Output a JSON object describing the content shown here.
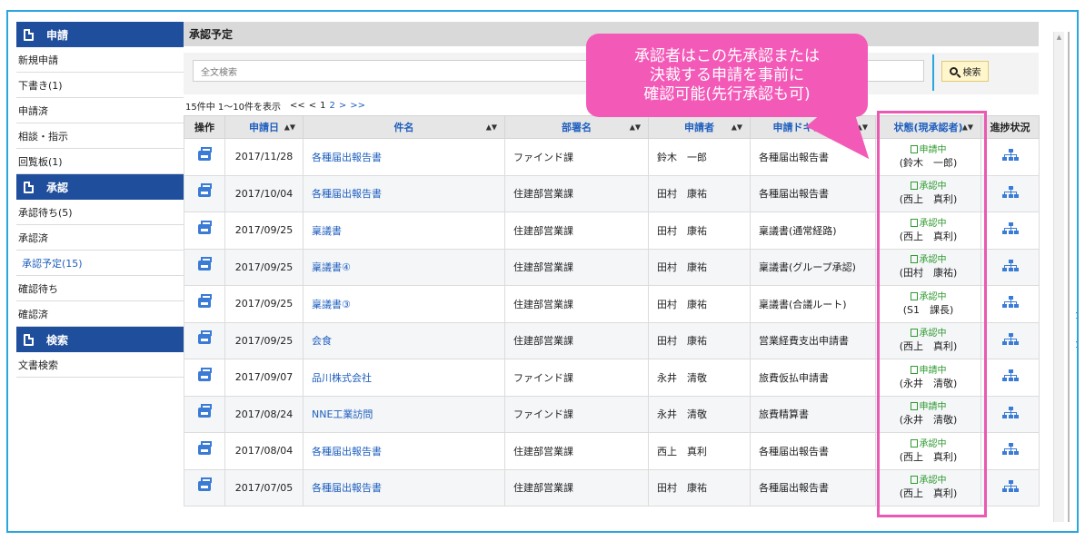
{
  "sidebar": {
    "sections": [
      {
        "title": "申請",
        "items": [
          {
            "label": "新規申請",
            "active": false
          },
          {
            "label": "下書き(1)",
            "active": false
          },
          {
            "label": "申請済",
            "active": false
          },
          {
            "label": "相談・指示",
            "active": false
          },
          {
            "label": "回覧板(1)",
            "active": false
          }
        ]
      },
      {
        "title": "承認",
        "items": [
          {
            "label": "承認待ち(5)",
            "active": false
          },
          {
            "label": "承認済",
            "active": false
          },
          {
            "label": "承認予定(15)",
            "active": true
          },
          {
            "label": "確認待ち",
            "active": false
          },
          {
            "label": "確認済",
            "active": false
          }
        ]
      },
      {
        "title": "検索",
        "items": [
          {
            "label": "文書検索",
            "active": false
          }
        ]
      }
    ]
  },
  "main": {
    "title": "承認予定",
    "search": {
      "placeholder": "全文検索",
      "button_label": "検索"
    },
    "paging": {
      "summary": "15件中 1〜10件を表示",
      "first": "<<",
      "prev": "<",
      "pages": [
        "1",
        "2"
      ],
      "next": ">",
      "last": ">>"
    },
    "columns": [
      "操作",
      "申請日",
      "件名",
      "部署名",
      "申請者",
      "申請ドキュメント",
      "状態(現承認者)",
      "進捗状況"
    ],
    "rows": [
      {
        "date": "2017/11/28",
        "subject": "各種届出報告書",
        "dept": "ファインド課",
        "applicant": "鈴木　一郎",
        "document": "各種届出報告書",
        "status": "申請中",
        "approver": "(鈴木　一郎)"
      },
      {
        "date": "2017/10/04",
        "subject": "各種届出報告書",
        "dept": "住建部営業課",
        "applicant": "田村　康祐",
        "document": "各種届出報告書",
        "status": "承認中",
        "approver": "(西上　真利)"
      },
      {
        "date": "2017/09/25",
        "subject": "稟議書",
        "dept": "住建部営業課",
        "applicant": "田村　康祐",
        "document": "稟議書(通常経路)",
        "status": "承認中",
        "approver": "(西上　真利)"
      },
      {
        "date": "2017/09/25",
        "subject": "稟議書④",
        "dept": "住建部営業課",
        "applicant": "田村　康祐",
        "document": "稟議書(グループ承認)",
        "status": "承認中",
        "approver": "(田村　康祐)"
      },
      {
        "date": "2017/09/25",
        "subject": "稟議書③",
        "dept": "住建部営業課",
        "applicant": "田村　康祐",
        "document": "稟議書(合議ルート)",
        "status": "承認中",
        "approver": "(S1　課長)"
      },
      {
        "date": "2017/09/25",
        "subject": "会食",
        "dept": "住建部営業課",
        "applicant": "田村　康祐",
        "document": "営業経費支出申請書",
        "status": "承認中",
        "approver": "(西上　真利)"
      },
      {
        "date": "2017/09/07",
        "subject": "品川株式会社",
        "dept": "ファインド課",
        "applicant": "永井　清敬",
        "document": "旅費仮払申請書",
        "status": "申請中",
        "approver": "(永井　清敬)"
      },
      {
        "date": "2017/08/24",
        "subject": "NNE工業訪問",
        "dept": "ファインド課",
        "applicant": "永井　清敬",
        "document": "旅費精算書",
        "status": "申請中",
        "approver": "(永井　清敬)"
      },
      {
        "date": "2017/08/04",
        "subject": "各種届出報告書",
        "dept": "住建部営業課",
        "applicant": "西上　真利",
        "document": "各種届出報告書",
        "status": "承認中",
        "approver": "(西上　真利)"
      },
      {
        "date": "2017/07/05",
        "subject": "各種届出報告書",
        "dept": "住建部営業課",
        "applicant": "田村　康祐",
        "document": "各種届出報告書",
        "status": "承認中",
        "approver": "(西上　真利)"
      }
    ]
  },
  "callout": {
    "lines": [
      "承認者はこの先承認または",
      "決裁する申請を事前に",
      "確認可能(先行承認も可)"
    ]
  },
  "edge_marks": [
    "1",
    "1"
  ],
  "colors": {
    "accent_blue": "#1f4e9c",
    "link": "#1f5fbf",
    "highlight_pink": "#ea59b2",
    "status_green": "#2f9a2f"
  }
}
